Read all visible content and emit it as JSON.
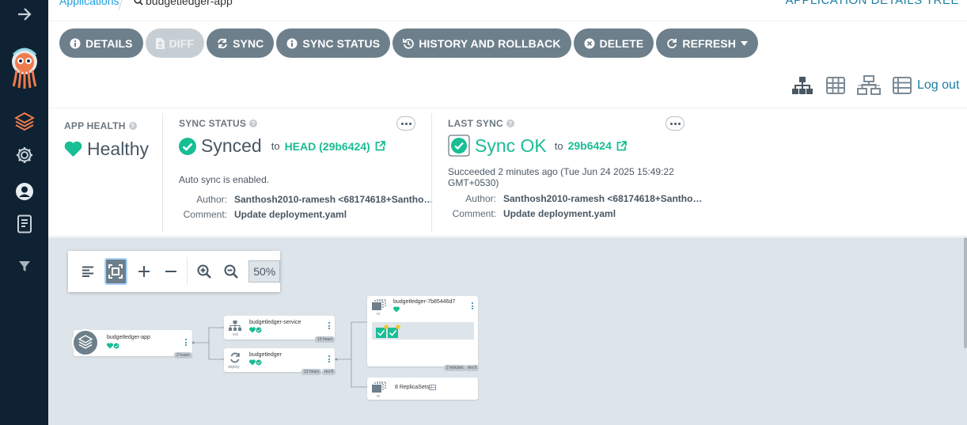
{
  "breadcrumb": {
    "applications_label": "Applications",
    "current_app": "budgetledger-app",
    "view_title": "APPLICATION DETAILS TREE"
  },
  "toolbar": {
    "details": "DETAILS",
    "diff": "DIFF",
    "sync": "SYNC",
    "sync_status": "SYNC STATUS",
    "history": "HISTORY AND ROLLBACK",
    "delete": "DELETE",
    "refresh": "REFRESH"
  },
  "views": {
    "icons": [
      "tree-view-icon",
      "pods-view-icon",
      "network-view-icon",
      "list-view-icon"
    ],
    "logout": "Log out"
  },
  "app_health": {
    "label": "APP HEALTH",
    "status": "Healthy"
  },
  "sync_status": {
    "label": "SYNC STATUS",
    "status": "Synced",
    "to_text": "to",
    "revision": "HEAD (29b6424)",
    "auto_sync": "Auto sync is enabled.",
    "author_key": "Author:",
    "author_value": "Santhosh2010-ramesh <68174618+Santho…",
    "comment_key": "Comment:",
    "comment_value": "Update deployment.yaml"
  },
  "last_sync": {
    "label": "LAST SYNC",
    "status": "Sync OK",
    "to_text": "to",
    "revision": "29b6424",
    "succeeded": "Succeeded 2 minutes ago (Tue Jun 24 2025 15:49:22 GMT+0530)",
    "author_key": "Author:",
    "author_value": "Santhosh2010-ramesh <68174618+Santho…",
    "comment_key": "Comment:",
    "comment_value": "Update deployment.yaml"
  },
  "zoom": {
    "value": "50%"
  },
  "graph": {
    "app_node": {
      "name": "budgetledger-app",
      "age": "2 hours"
    },
    "service_node": {
      "name": "budgetledger-service",
      "kind": "svc",
      "age": "13 hours"
    },
    "deploy_node": {
      "name": "budgetledger",
      "kind": "deploy",
      "age": "13 hours",
      "rev": "rev:9"
    },
    "rs_node": {
      "name": "budgetledger-7b85446d7",
      "kind": "rs",
      "age": "2 minutes",
      "rev": "rev:9"
    },
    "replicasets_node": {
      "name": "8 ReplicaSets",
      "kind": "rs"
    }
  },
  "colors": {
    "nav_bg": "#0e2233",
    "button_bg": "#6d7f8b",
    "healthy_green": "#18be94",
    "link_blue": "#1a7fa3",
    "graph_bg": "#dee5ea"
  }
}
